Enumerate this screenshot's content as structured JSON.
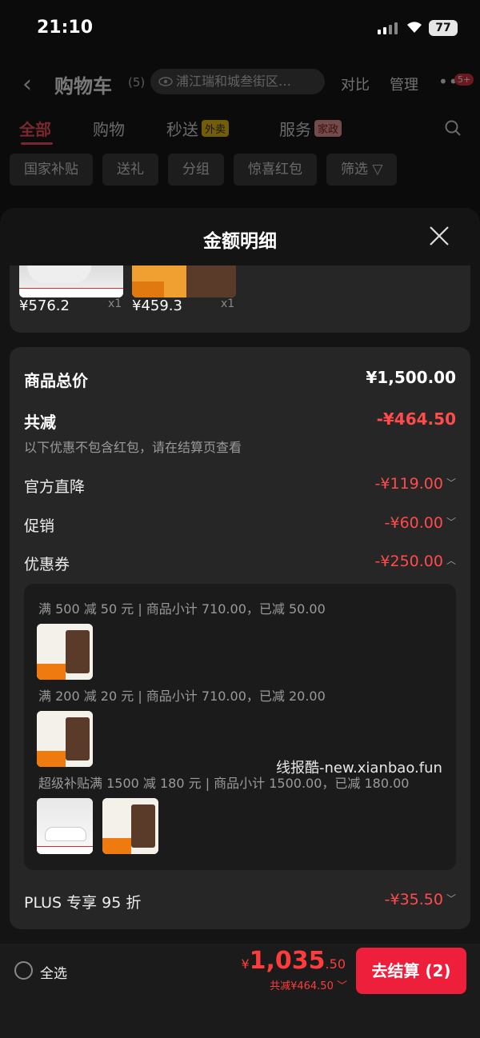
{
  "status_bar": {
    "time": "21:10",
    "battery": "77"
  },
  "header": {
    "title": "购物车",
    "count": "(5)",
    "address": "浦江瑞和城叁街区…",
    "compare": "对比",
    "manage": "管理",
    "more_badge": "5+"
  },
  "tabs": [
    {
      "label": "全部"
    },
    {
      "label": "购物"
    },
    {
      "label": "秒送",
      "tag": "外卖"
    },
    {
      "label": "服务",
      "tag": "家政"
    }
  ],
  "filters": [
    "国家补贴",
    "送礼",
    "分组",
    "惊喜红包",
    "筛选"
  ],
  "sheet": {
    "title": "金额明细",
    "products": [
      {
        "price": "¥576.2",
        "qty": "x1"
      },
      {
        "price": "¥459.3",
        "qty": "x1"
      }
    ],
    "subtotal": {
      "label": "商品总价",
      "value": "¥1,500.00"
    },
    "total_off": {
      "label": "共减",
      "value": "-¥464.50",
      "note": "以下优惠不包含红包，请在结算页查看"
    },
    "lines": [
      {
        "label": "官方直降",
        "value": "-¥119.00"
      },
      {
        "label": "促销",
        "value": "-¥60.00"
      },
      {
        "label": "优惠券",
        "value": "-¥250.00"
      }
    ],
    "coupons": [
      {
        "text": "满 500 减 50 元 | 商品小计 710.00，已减 50.00"
      },
      {
        "text": "满 200 减 20 元 | 商品小计 710.00，已减 20.00"
      },
      {
        "text": "超级补贴满 1500 减 180 元 | 商品小计 1500.00，已减 180.00"
      }
    ],
    "plus": {
      "label": "PLUS 专享 95 折",
      "value": "-¥35.50"
    }
  },
  "watermark": "线报酷-new.xianbao.fun",
  "bottom": {
    "select_all": "全选",
    "yen": "¥",
    "total_int": "1,035",
    "total_dec": ".50",
    "saved": "共减¥464.50",
    "checkout": "去结算 (2)"
  }
}
